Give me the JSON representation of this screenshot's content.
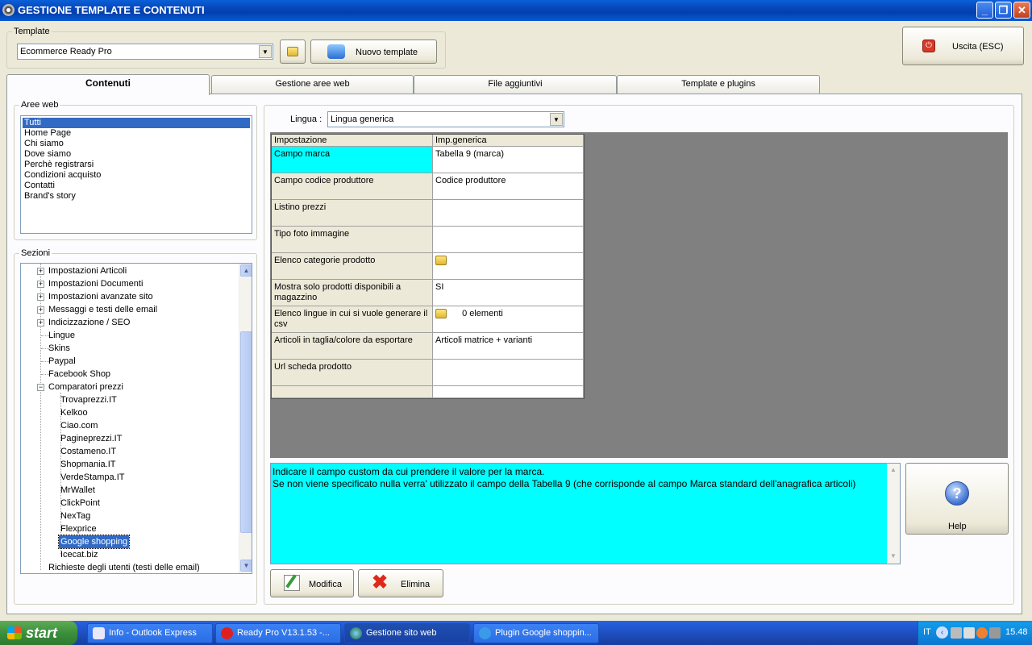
{
  "window": {
    "title": "GESTIONE TEMPLATE E CONTENUTI"
  },
  "template": {
    "label": "Template",
    "selected": "Ecommerce Ready Pro",
    "new_button": "Nuovo template"
  },
  "exit_button": "Uscita (ESC)",
  "tabs": [
    "Contenuti",
    "Gestione aree web",
    "File aggiuntivi",
    "Template e plugins"
  ],
  "aree_web": {
    "label": "Aree web",
    "items": [
      "Tutti",
      "Home Page",
      "Chi siamo",
      "Dove siamo",
      "Perchè registrarsi",
      "Condizioni acquisto",
      "Contatti",
      "Brand's story"
    ],
    "selected": "Tutti"
  },
  "sezioni": {
    "label": "Sezioni",
    "top_nodes": [
      "Impostazioni Articoli",
      "Impostazioni Documenti",
      "Impostazioni avanzate sito",
      "Messaggi e testi delle email",
      "Indicizzazione / SEO",
      "Lingue",
      "Skins",
      "Paypal",
      "Facebook Shop",
      "Comparatori prezzi"
    ],
    "children": [
      "Trovaprezzi.IT",
      "Kelkoo",
      "Ciao.com",
      "Pagineprezzi.IT",
      "Costameno.IT",
      "Shopmania.IT",
      "VerdeStampa.IT",
      "MrWallet",
      "ClickPoint",
      "NexTag",
      "Flexprice",
      "Google shopping",
      "Icecat.biz"
    ],
    "last_node": "Richieste degli utenti (testi delle email)",
    "selected": "Google shopping"
  },
  "lingua": {
    "label": "Lingua :",
    "selected": "Lingua generica"
  },
  "grid": {
    "headers": [
      "Impostazione",
      "Imp.generica"
    ],
    "rows": [
      {
        "setting": "Campo marca",
        "value": "Tabella 9 (marca)"
      },
      {
        "setting": "Campo codice produttore",
        "value": "Codice produttore"
      },
      {
        "setting": "Listino prezzi",
        "value": ""
      },
      {
        "setting": "Tipo foto immagine",
        "value": ""
      },
      {
        "setting": "Elenco categorie prodotto",
        "value": ""
      },
      {
        "setting": "Mostra solo prodotti disponibili a magazzino",
        "value": "SI"
      },
      {
        "setting": "Elenco lingue in cui si vuole generare il csv",
        "value": "0 elementi"
      },
      {
        "setting": "Articoli in taglia/colore da esportare",
        "value": "Articoli matrice + varianti"
      },
      {
        "setting": "Url scheda prodotto",
        "value": ""
      }
    ],
    "selected_row": "Campo marca"
  },
  "description": {
    "line1": "Indicare il campo custom da cui prendere il valore per la marca.",
    "line2": "Se non viene specificato nulla verra' utilizzato il campo della Tabella 9 (che corrisponde al campo Marca standard dell'anagrafica articoli)"
  },
  "help_button": "Help",
  "modifica_button": "Modifica",
  "elimina_button": "Elimina",
  "taskbar": {
    "start": "start",
    "tasks": [
      "Info - Outlook Express",
      "Ready Pro V13.1.53 -...",
      "Gestione sito web",
      "Plugin Google shoppin..."
    ],
    "lang": "IT",
    "clock": "15.48"
  },
  "colors": {
    "highlight": "#316ac5",
    "cyan": "#00ffff",
    "grid_bg": "#808080"
  }
}
